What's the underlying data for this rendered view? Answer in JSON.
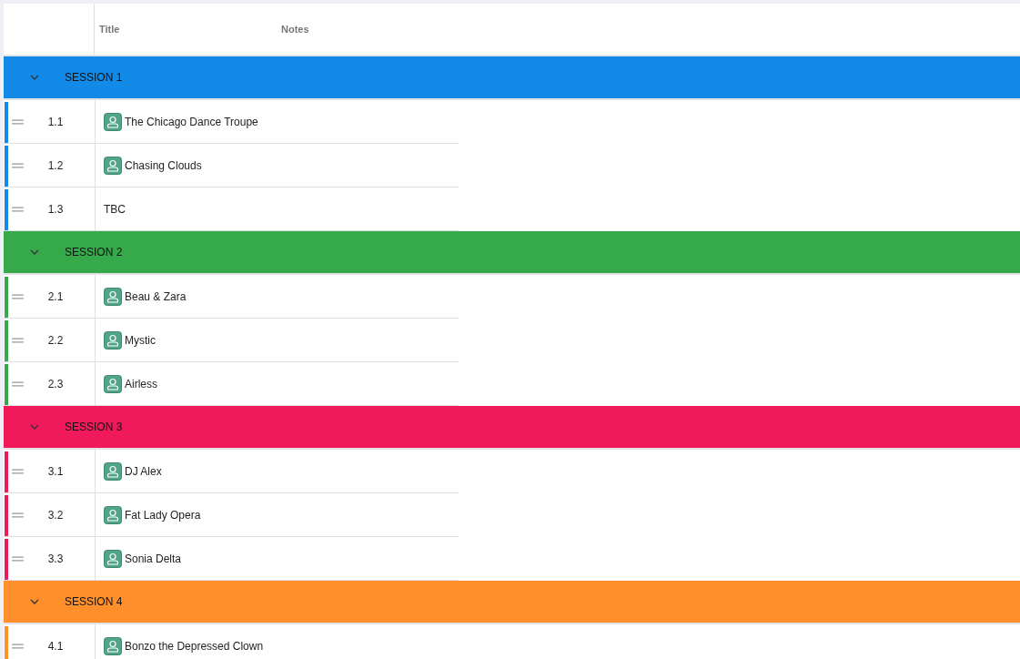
{
  "table": {
    "columns": [
      {
        "label": "Title"
      },
      {
        "label": "Notes"
      }
    ]
  },
  "sessions": [
    {
      "title": "SESSION 1",
      "color": "#118ae8",
      "expanded": true,
      "items": [
        {
          "number": "1.1",
          "title": "The Chicago Dance Troupe",
          "kind": "act"
        },
        {
          "number": "1.2",
          "title": "Chasing Clouds",
          "kind": "act"
        },
        {
          "number": "1.3",
          "title": "TBC",
          "kind": "text"
        }
      ]
    },
    {
      "title": "SESSION 2",
      "color": "#36a94b",
      "expanded": true,
      "items": [
        {
          "number": "2.1",
          "title": "Beau & Zara",
          "kind": "act"
        },
        {
          "number": "2.2",
          "title": "Mystic",
          "kind": "act"
        },
        {
          "number": "2.3",
          "title": "Airless",
          "kind": "act"
        }
      ]
    },
    {
      "title": "SESSION 3",
      "color": "#ef195b",
      "expanded": true,
      "items": [
        {
          "number": "3.1",
          "title": "DJ Alex",
          "kind": "act"
        },
        {
          "number": "3.2",
          "title": "Fat Lady Opera",
          "kind": "act"
        },
        {
          "number": "3.3",
          "title": "Sonia Delta",
          "kind": "act"
        }
      ]
    },
    {
      "title": "SESSION 4",
      "color": "#fe8f2a",
      "expanded": true,
      "items": [
        {
          "number": "4.1",
          "title": "Bonzo the Depressed Clown",
          "kind": "act"
        }
      ]
    }
  ]
}
